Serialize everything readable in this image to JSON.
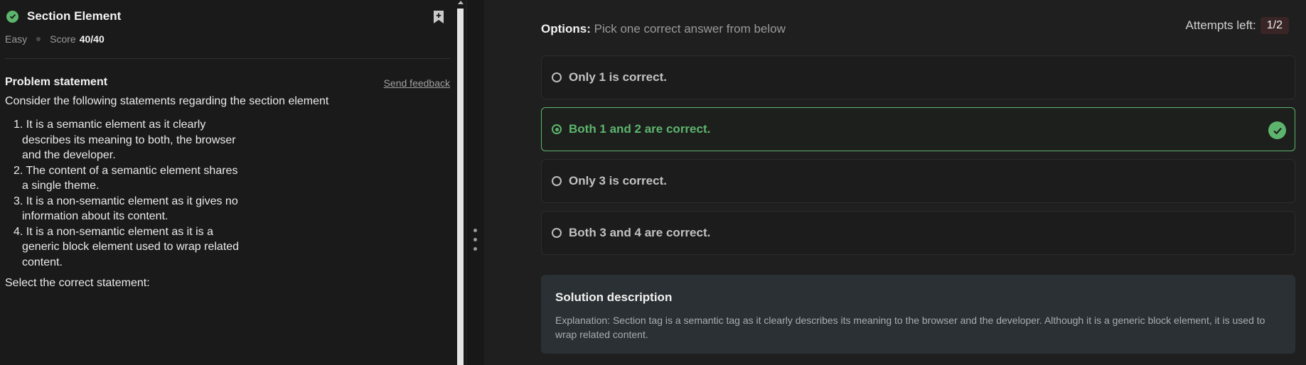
{
  "problem": {
    "title": "Section Element",
    "difficulty": "Easy",
    "score_label": "Score",
    "score_value": "40/40",
    "statement_heading": "Problem statement",
    "feedback_link": "Send feedback",
    "intro": "Consider the following statements regarding the section element",
    "statements": [
      "1. It is a semantic element as it clearly describes its meaning to both, the browser and the developer.",
      "2. The content of a semantic element shares a single theme.",
      "3. It is a non-semantic element as it gives no information about its content.",
      "4. It is a non-semantic element as it is a generic block element used to wrap related content."
    ],
    "question": "Select the correct statement:"
  },
  "options_panel": {
    "heading": "Options:",
    "subheading": "Pick one correct answer from below",
    "attempts_label": "Attempts left:",
    "attempts_value": "1/2",
    "options": [
      {
        "label": "Only 1 is correct.",
        "selected": false
      },
      {
        "label": "Both 1 and 2 are correct.",
        "selected": true,
        "correct": true
      },
      {
        "label": "Only 3 is correct.",
        "selected": false
      },
      {
        "label": "Both 3 and 4 are correct.",
        "selected": false
      }
    ]
  },
  "solution": {
    "title": "Solution description",
    "text": "Explanation: Section tag is a semantic tag as it clearly describes its meaning to the browser and the developer. Although it is a generic block element, it is used to wrap related content."
  },
  "colors": {
    "success": "#5db56d",
    "panel_bg": "#1a1a1a",
    "solution_bg": "#2a3033"
  }
}
